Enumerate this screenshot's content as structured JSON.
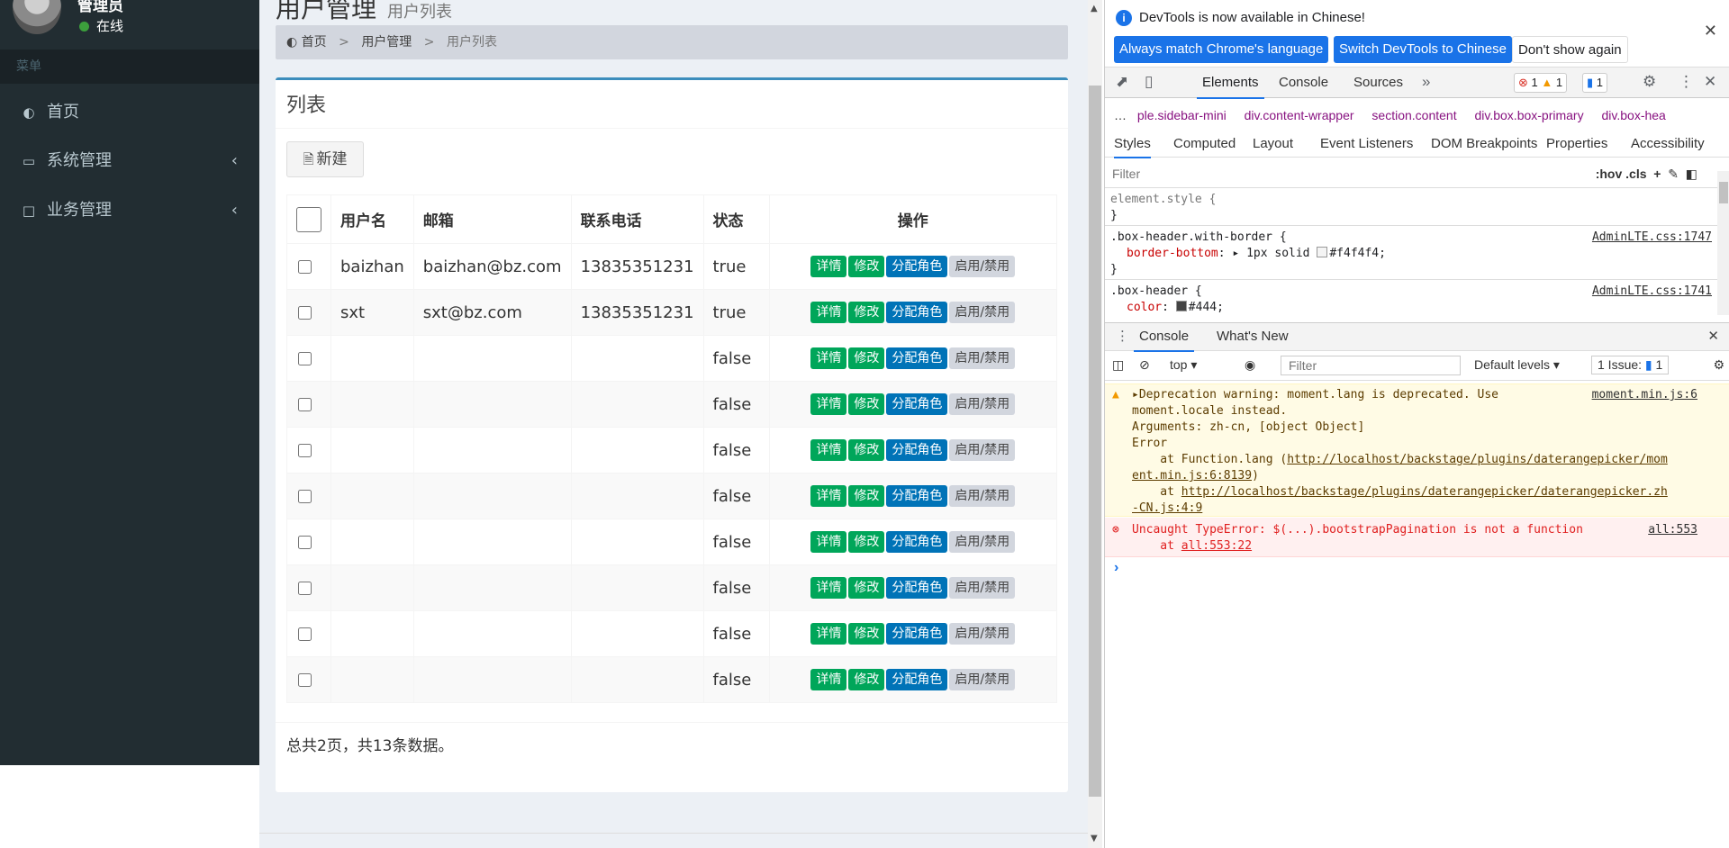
{
  "sidebar": {
    "user_name": "管理员",
    "user_status": "在线",
    "menu_header": "菜单",
    "items": [
      {
        "label": "首页",
        "icon": "dashboard-icon"
      },
      {
        "label": "系统管理",
        "icon": "folder-icon"
      },
      {
        "label": "业务管理",
        "icon": "laptop-icon"
      }
    ]
  },
  "content": {
    "title": "用户管理",
    "subtitle": "用户列表",
    "breadcrumb": [
      "首页",
      "用户管理",
      "用户列表"
    ],
    "box_title": "列表",
    "new_button": "新建",
    "columns": [
      "用户名",
      "邮箱",
      "联系电话",
      "状态",
      "操作"
    ],
    "action_labels": {
      "detail": "详情",
      "edit": "修改",
      "assign_role": "分配角色",
      "toggle": "启用/禁用"
    },
    "rows": [
      {
        "username": "baizhan",
        "email": "baizhan@bz.com",
        "phone": "13835351231",
        "status": "true"
      },
      {
        "username": "sxt",
        "email": "sxt@bz.com",
        "phone": "13835351231",
        "status": "true"
      },
      {
        "username": "",
        "email": "",
        "phone": "",
        "status": "false"
      },
      {
        "username": "",
        "email": "",
        "phone": "",
        "status": "false"
      },
      {
        "username": "",
        "email": "",
        "phone": "",
        "status": "false"
      },
      {
        "username": "",
        "email": "",
        "phone": "",
        "status": "false"
      },
      {
        "username": "",
        "email": "",
        "phone": "",
        "status": "false"
      },
      {
        "username": "",
        "email": "",
        "phone": "",
        "status": "false"
      },
      {
        "username": "",
        "email": "",
        "phone": "",
        "status": "false"
      },
      {
        "username": "",
        "email": "",
        "phone": "",
        "status": "false"
      }
    ],
    "summary": "总共2页，共13条数据。"
  },
  "devtools": {
    "info_text": "DevTools is now available in Chinese!",
    "btn_match": "Always match Chrome's language",
    "btn_switch": "Switch DevTools to Chinese",
    "btn_dont_show": "Don't show again",
    "tabs": [
      "Elements",
      "Console",
      "Sources"
    ],
    "badges": {
      "errors": "1",
      "warnings": "1",
      "messages": "1"
    },
    "crumbs": [
      "ple.sidebar-mini",
      "div.content-wrapper",
      "section.content",
      "div.box.box-primary",
      "div.box-hea"
    ],
    "subtabs": [
      "Styles",
      "Computed",
      "Layout",
      "Event Listeners",
      "DOM Breakpoints",
      "Properties",
      "Accessibility"
    ],
    "styles_filter_placeholder": "Filter",
    "styles_tools": ":hov  .cls",
    "styles_lines": {
      "element_open": "element.style {",
      "element_close": "}",
      "rule1_selector": ".box-header.with-border {",
      "rule1_source": "AdminLTE.css:1747",
      "rule1_prop": "border-bottom",
      "rule1_value": "1px solid ",
      "rule1_color": "#f4f4f4;",
      "rule1_close": "}",
      "rule2_selector": ".box-header {",
      "rule2_source": "AdminLTE.css:1741",
      "rule2_prop": "color",
      "rule2_color": "#444;"
    },
    "drawer_tabs": [
      "Console",
      "What's New"
    ],
    "console_context": "top",
    "console_filter_placeholder": "Filter",
    "console_levels": "Default levels",
    "console_issues": "1 Issue:",
    "console_issue_count": "1",
    "warning": {
      "line1": "Deprecation warning: moment.lang is deprecated. Use",
      "line2": "moment.locale instead.",
      "line3": "Arguments: zh-cn, [object Object]",
      "line4": "Error",
      "line5_prefix": "    at Function.lang (",
      "line5_link": "http://localhost/backstage/plugins/daterangepicker/mom",
      "line6_link": "ent.min.js:6:8139",
      "line6_suffix": ")",
      "line7_prefix": "    at ",
      "line7_link": "http://localhost/backstage/plugins/daterangepicker/daterangepicker.zh",
      "line8_link": "-CN.js:4:9",
      "source": "moment.min.js:6"
    },
    "error": {
      "line1": "Uncaught TypeError: $(...).bootstrapPagination is not a function",
      "line2_prefix": "    at ",
      "line2_link": "all:553:22",
      "source": "all:553"
    }
  },
  "colors": {
    "sidebar_bg": "#222d32",
    "accent": "#3c8dbc",
    "success": "#00a65a",
    "primary": "#0073b7",
    "devtools_blue": "#1a73e8"
  }
}
